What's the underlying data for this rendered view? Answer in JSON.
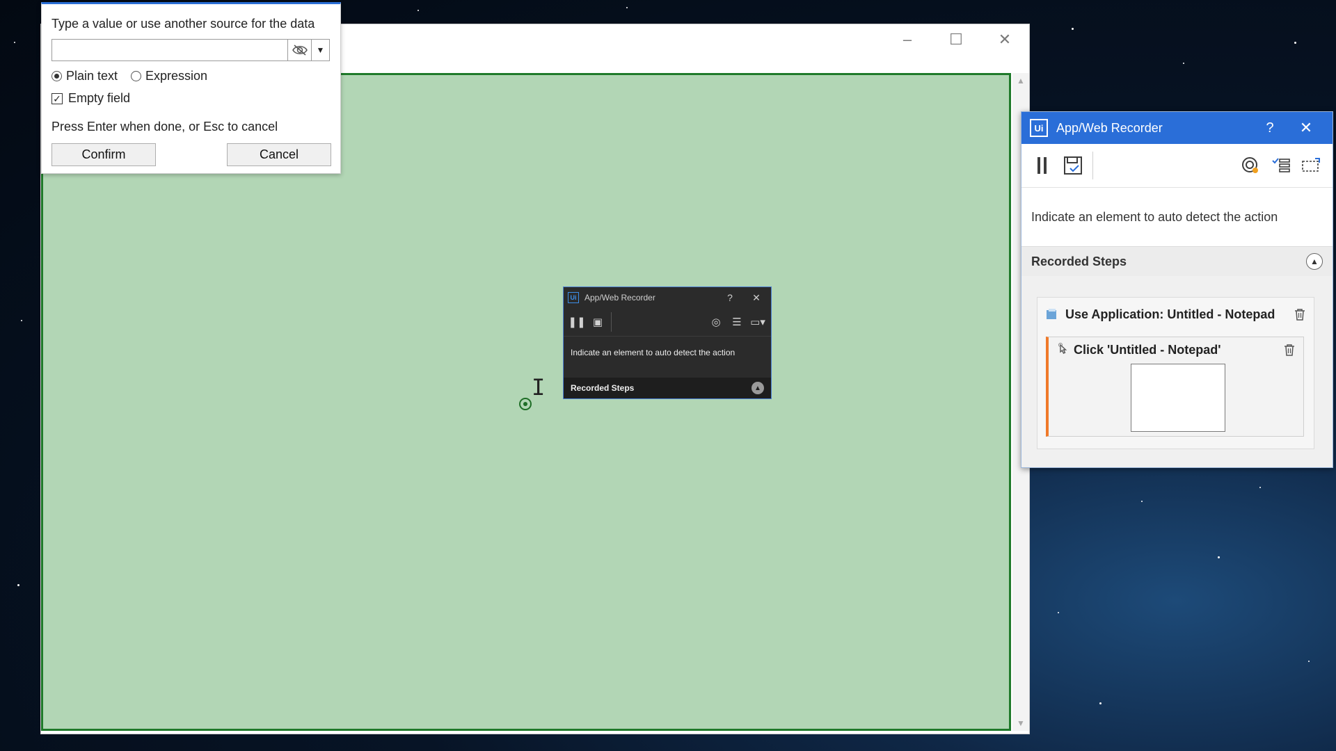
{
  "input_popup": {
    "title": "Type a value or use another source for the data",
    "value": "",
    "placeholder": "",
    "mode_options": [
      "Plain text",
      "Expression"
    ],
    "selected_mode": "Plain text",
    "empty_field_label": "Empty field",
    "empty_field_checked": true,
    "hint": "Press Enter when done, or Esc to cancel",
    "confirm_label": "Confirm",
    "cancel_label": "Cancel"
  },
  "main_window": {
    "controls": {
      "minimize": "–",
      "maximize": "☐",
      "close": "✕"
    }
  },
  "mini_recorder": {
    "logo": "Ui",
    "title": "App/Web Recorder",
    "help": "?",
    "close": "✕",
    "instruction": "Indicate an element to auto detect the action",
    "steps_header": "Recorded Steps"
  },
  "recorder": {
    "logo": "Ui",
    "title": "App/Web Recorder",
    "help": "?",
    "close": "✕",
    "instruction": "Indicate an element to auto detect the action",
    "steps_header": "Recorded Steps",
    "steps": [
      {
        "label": "Use Application: Untitled - Notepad",
        "icon": "notepad-icon"
      },
      {
        "label": "Click 'Untitled - Notepad'",
        "icon": "click-icon"
      }
    ]
  },
  "colors": {
    "accent": "#2a6ed8",
    "highlight_fill": "#b2d6b5",
    "highlight_border": "#1f7a2a",
    "step_marker": "#f07a2a"
  }
}
